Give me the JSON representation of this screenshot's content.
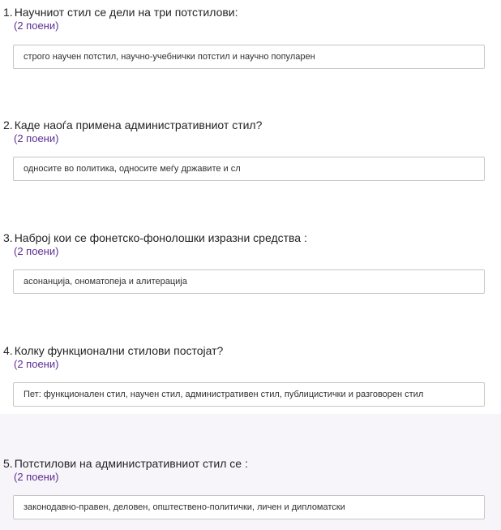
{
  "questions": [
    {
      "number": "1.",
      "title": "Научниот стил се дели на три потстилови:",
      "points": "(2 поени)",
      "answer": "строго научен потстил, научно-учебнички потстил и научно популарен"
    },
    {
      "number": "2.",
      "title": "Каде наоѓа примена административниот стил?",
      "points": "(2 поени)",
      "answer": "односите во политика, односите меѓу државите и сл"
    },
    {
      "number": "3.",
      "title": "Наброј кои се фонетско-фонолошки изразни средства :",
      "points": "(2 поени)",
      "answer": "асонанција, ономатопеја и алитерација"
    },
    {
      "number": "4.",
      "title": "Колку функционални стилови постојат?",
      "points": "(2 поени)",
      "answer": "Пет: функционален стил, научен стил, административен стил, публицистички и разговорен стил"
    },
    {
      "number": "5.",
      "title": "Потстилови на административниот стил се :",
      "points": "(2 поени)",
      "answer": "законодавно-правен, деловен, општествено-политички, личен и дипломатски"
    }
  ],
  "colors": {
    "points_accent": "#5c2d91",
    "focused_background": "#f7f5fa"
  }
}
